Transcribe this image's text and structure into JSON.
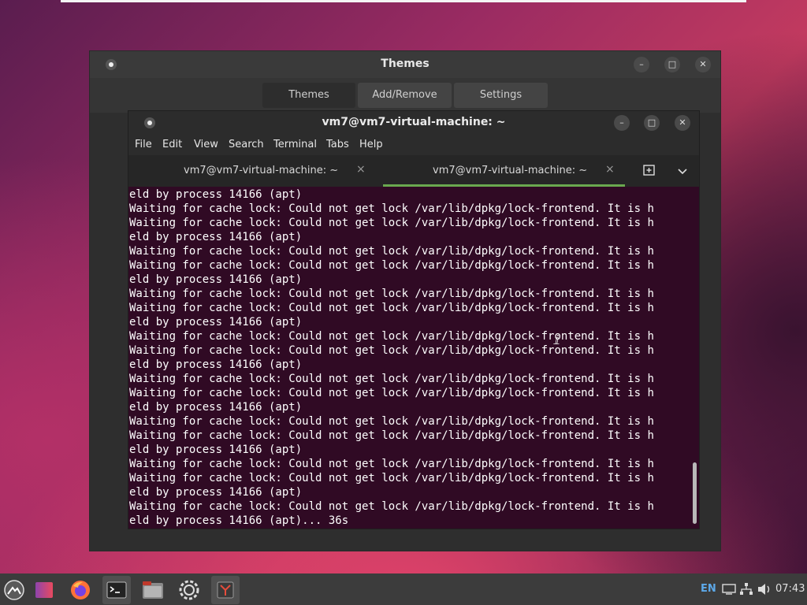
{
  "themes_window": {
    "title": "Themes",
    "tabs": [
      {
        "label": "Themes"
      },
      {
        "label": "Add/Remove"
      },
      {
        "label": "Settings"
      }
    ]
  },
  "terminal": {
    "title": "vm7@vm7-virtual-machine: ~",
    "menu": [
      "File",
      "Edit",
      "View",
      "Search",
      "Terminal",
      "Tabs",
      "Help"
    ],
    "tabs": [
      {
        "label": "vm7@vm7-virtual-machine: ~",
        "active": false
      },
      {
        "label": "vm7@vm7-virtual-machine: ~",
        "active": true
      }
    ],
    "lines": [
      "eld by process 14166 (apt)",
      "Waiting for cache lock: Could not get lock /var/lib/dpkg/lock-frontend. It is h",
      "Waiting for cache lock: Could not get lock /var/lib/dpkg/lock-frontend. It is h",
      "eld by process 14166 (apt)",
      "Waiting for cache lock: Could not get lock /var/lib/dpkg/lock-frontend. It is h",
      "Waiting for cache lock: Could not get lock /var/lib/dpkg/lock-frontend. It is h",
      "eld by process 14166 (apt)",
      "Waiting for cache lock: Could not get lock /var/lib/dpkg/lock-frontend. It is h",
      "Waiting for cache lock: Could not get lock /var/lib/dpkg/lock-frontend. It is h",
      "eld by process 14166 (apt)",
      "Waiting for cache lock: Could not get lock /var/lib/dpkg/lock-frontend. It is h",
      "Waiting for cache lock: Could not get lock /var/lib/dpkg/lock-frontend. It is h",
      "eld by process 14166 (apt)",
      "Waiting for cache lock: Could not get lock /var/lib/dpkg/lock-frontend. It is h",
      "Waiting for cache lock: Could not get lock /var/lib/dpkg/lock-frontend. It is h",
      "eld by process 14166 (apt)",
      "Waiting for cache lock: Could not get lock /var/lib/dpkg/lock-frontend. It is h",
      "Waiting for cache lock: Could not get lock /var/lib/dpkg/lock-frontend. It is h",
      "eld by process 14166 (apt)",
      "Waiting for cache lock: Could not get lock /var/lib/dpkg/lock-frontend. It is h",
      "Waiting for cache lock: Could not get lock /var/lib/dpkg/lock-frontend. It is h",
      "eld by process 14166 (apt)",
      "Waiting for cache lock: Could not get lock /var/lib/dpkg/lock-frontend. It is h",
      "eld by process 14166 (apt)... 36s"
    ]
  },
  "panel": {
    "launchers": [
      "menu-icon",
      "themes-icon",
      "firefox-icon",
      "terminal-icon",
      "files-icon",
      "settings-icon",
      "app-icon"
    ],
    "keyboard_layout": "EN",
    "clock": "07:43"
  },
  "colors": {
    "terminal_bg": "#300a24",
    "active_tab_underline": "#6aa84f"
  }
}
